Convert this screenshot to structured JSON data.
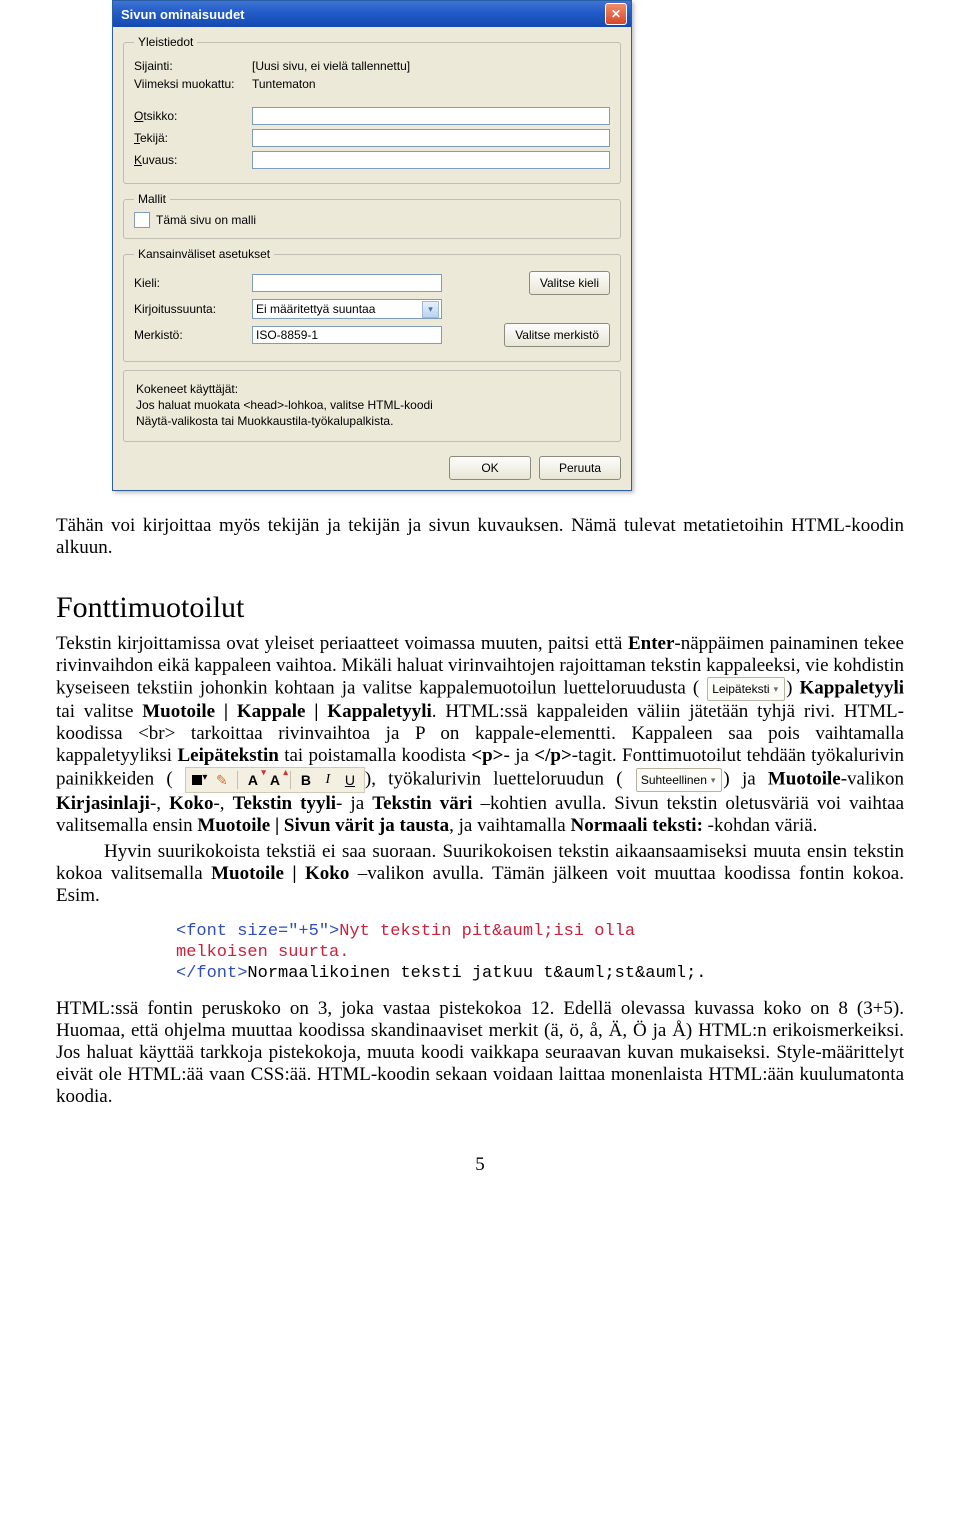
{
  "dialog": {
    "title": "Sivun ominaisuudet",
    "groups": {
      "general": {
        "legend": "Yleistiedot",
        "location_label": "Sijainti:",
        "location_value": "[Uusi sivu, ei vielä tallennettu]",
        "modified_label": "Viimeksi muokattu:",
        "modified_value": "Tuntematon",
        "title_label_pre": "O",
        "title_label_post": "tsikko:",
        "author_label_pre": "T",
        "author_label_post": "ekijä:",
        "desc_label_pre": "K",
        "desc_label_post": "uvaus:"
      },
      "templates": {
        "legend": "Mallit",
        "checkbox_label": "Tämä sivu on malli"
      },
      "intl": {
        "legend": "Kansainväliset asetukset",
        "lang_label": "Kieli:",
        "choose_lang_btn": "Valitse kieli",
        "dir_label": "Kirjoitussuunta:",
        "dir_value": "Ei määritettyä suuntaa",
        "charset_label": "Merkistö:",
        "charset_value": "ISO-8859-1",
        "choose_charset_btn": "Valitse merkistö"
      },
      "advanced": {
        "line1": "Kokeneet käyttäjät:",
        "line2": "Jos haluat muokata <head>-lohkoa, valitse HTML-koodi",
        "line3": "Näytä-valikosta tai Muokkaustila-työkalupalkista."
      }
    },
    "footer": {
      "ok": "OK",
      "cancel": "Peruuta"
    }
  },
  "caption": "Tähän voi kirjoittaa myös tekijän ja tekijän ja sivun kuvauksen. Nämä tulevat metatietoihin HTML-koodin alkuun.",
  "section_font_heading": "Fonttimuotoilut",
  "inline_images": {
    "leipateksti": "Leipäteksti",
    "suhteellinen": "Suhteellinen"
  },
  "long1_pre_enter": "Tekstin kirjoittamissa ovat yleiset periaatteet voimassa muuten, paitsi että ",
  "long1_enter": "Enter",
  "long1_post_enter": "-näppäimen painaminen tekee rivinvaihdon eikä kappaleen vaihtoa. Mikäli haluat virinvaihtojen rajoittaman tekstin kappaleeksi, vie kohdistin kyseiseen tekstiin johonkin kohtaan ja valitse kappalemuotoilun luetteloruudusta (",
  "long1_after_img1": ") ",
  "long1_kappaletyyli": "Kappaletyyli",
  "long1_cont1": " tai valitse ",
  "long1_menu1": "Muotoile | Kappale | Kappaletyyli",
  "long1_cont2": ". HTML:ssä kappaleiden väliin jätetään tyhjä rivi. HTML-koodissa <br> tarkoittaa rivinvaihtoa ja P on kappale-elementti. Kappaleen saa pois vaihtamalla kappaletyyliksi ",
  "long1_leipatekstin": "Leipätekstin",
  "long1_cont3": " tai poistamalla koodista ",
  "long1_ptag_open": "<p>",
  "long1_cont4": "- ja ",
  "long1_ptag_close": "</p>",
  "long1_cont5": "-tagit. Fonttimuotoilut tehdään työkalurivin painikkeiden (",
  "long1_after_toolbar": "), työkalurivin luetteloruudun (",
  "long1_after_img2": ") ja ",
  "long1_muotoile": "Muotoile",
  "long1_cont6": "-valikon ",
  "long1_kirjasinlaji": "Kirjasinlaji",
  "long1_cont7": "-, ",
  "long1_koko": "Koko",
  "long1_cont8": "-, ",
  "long1_tyyli": "Tekstin tyyli",
  "long1_cont9": "- ja ",
  "long1_vari": "Tekstin väri",
  "long1_cont10": " –kohtien avulla. Sivun tekstin oletusväriä voi vaihtaa valitsemalla ensin ",
  "long1_menu2": "Muotoile | Sivun värit ja tausta",
  "long1_cont11": ", ja vaihtamalla ",
  "long1_normaali": "Normaali teksti:",
  "long1_cont12": " -kohdan väriä.",
  "long2_pre": "Hyvin suurikokoista tekstiä ei saa suoraan. Suurikokoisen tekstin aikaansaamiseksi muuta ensin tekstin kokoa valitsemalla ",
  "long2_menu": "Muotoile | Koko",
  "long2_post": " –valikon avulla. Tämän jälkeen voit muuttaa koodissa fontin kokoa. Esim.",
  "code": {
    "l1a": "<font size=\"+5\">",
    "l1b": "Nyt tekstin pit&auml;isi olla",
    "l2": "melkoisen suurta.",
    "l3a": "</font>",
    "l3b": "Normaalikoinen teksti jatkuu t&auml;st&auml;."
  },
  "final_para": "HTML:ssä fontin peruskoko on 3, joka vastaa pistekokoa 12. Edellä olevassa kuvassa koko on 8 (3+5). Huomaa, että ohjelma muuttaa koodissa skandinaaviset merkit (ä, ö, å, Ä, Ö ja Å) HTML:n erikoismerkeiksi. Jos haluat käyttää tarkkoja pistekokoja, muuta koodi vaikkapa seuraavan kuvan mukaiseksi. Style-määrittelyt eivät ole HTML:ää vaan CSS:ää. HTML-koodin sekaan voidaan laittaa monenlaista HTML:ään kuulumatonta koodia.",
  "page_number": "5"
}
